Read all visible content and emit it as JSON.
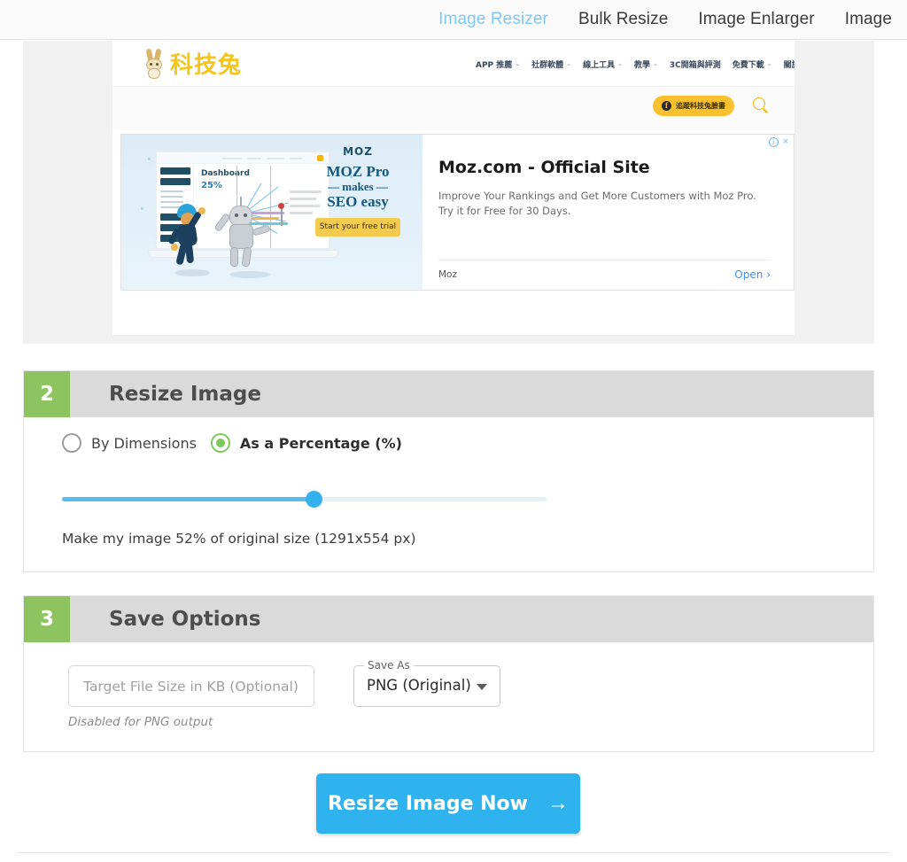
{
  "topnav": {
    "items": [
      {
        "label": "Image Resizer",
        "active": true
      },
      {
        "label": "Bulk Resize",
        "active": false
      },
      {
        "label": "Image Enlarger",
        "active": false
      },
      {
        "label": "Image",
        "active": false
      }
    ]
  },
  "preview": {
    "site": {
      "logo_text": "科技兔",
      "nav": [
        {
          "label": "APP 推薦",
          "caret": "⌄"
        },
        {
          "label": "社群軟體",
          "caret": "⌄"
        },
        {
          "label": "線上工具",
          "caret": "⌄"
        },
        {
          "label": "教學",
          "caret": "⌄"
        },
        {
          "label": "3C開箱與評測",
          "caret": ""
        },
        {
          "label": "免費下載",
          "caret": "⌄"
        },
        {
          "label": "關於科技兔",
          "caret": ""
        }
      ],
      "follow_button": "追蹤科技兔臉書",
      "follow_icon": "facebook-icon",
      "search_icon": "search-icon"
    },
    "ad": {
      "creative": {
        "brand": "MOZ",
        "headline_line1": "MOZ Pro",
        "headline_line2": "— makes —",
        "headline_line3": "SEO easy",
        "cta": "Start your free trial",
        "dashboard_title": "Dashboard",
        "dashboard_pct": "25%"
      },
      "title": "Moz.com - Official Site",
      "description": "Improve Your Rankings and Get More Customers with Moz Pro. Try it for Free for 30 Days.",
      "brand": "Moz",
      "open_label": "Open",
      "open_chevron": "›",
      "adchoices_icon": "adchoices-icon",
      "close_icon": "close-icon",
      "close_glyph": "×"
    }
  },
  "sections": [
    {
      "number": "2",
      "title": "Resize Image",
      "radio_options": [
        {
          "label": "By Dimensions",
          "selected": false
        },
        {
          "label": "As a Percentage (%)",
          "selected": true
        }
      ],
      "slider": {
        "percent": 52,
        "min": 0,
        "max": 100,
        "fill_color": "#56bcf0",
        "track_color": "#e3f1fb",
        "thumb_color": "#34b0ed"
      },
      "caption": "Make my image  52% of original size (1291x554 px)"
    },
    {
      "number": "3",
      "title": "Save Options",
      "filesize_placeholder": "Target File Size in KB (Optional)",
      "filesize_value": "",
      "filesize_note": "Disabled for PNG output",
      "saveas_label": "Save As",
      "saveas_value": "PNG (Original)",
      "saveas_caret_icon": "chevron-down-icon"
    }
  ],
  "cta": {
    "label": "Resize Image Now",
    "arrow": "→",
    "arrow_icon": "arrow-right-icon",
    "color": "#2fb3ef"
  },
  "colors": {
    "accent_blue": "#2fb3ef",
    "step_green": "#8ec45f",
    "radio_green": "#7dc95c",
    "nav_active": "#7dc8f7",
    "section_header": "#dadada"
  }
}
